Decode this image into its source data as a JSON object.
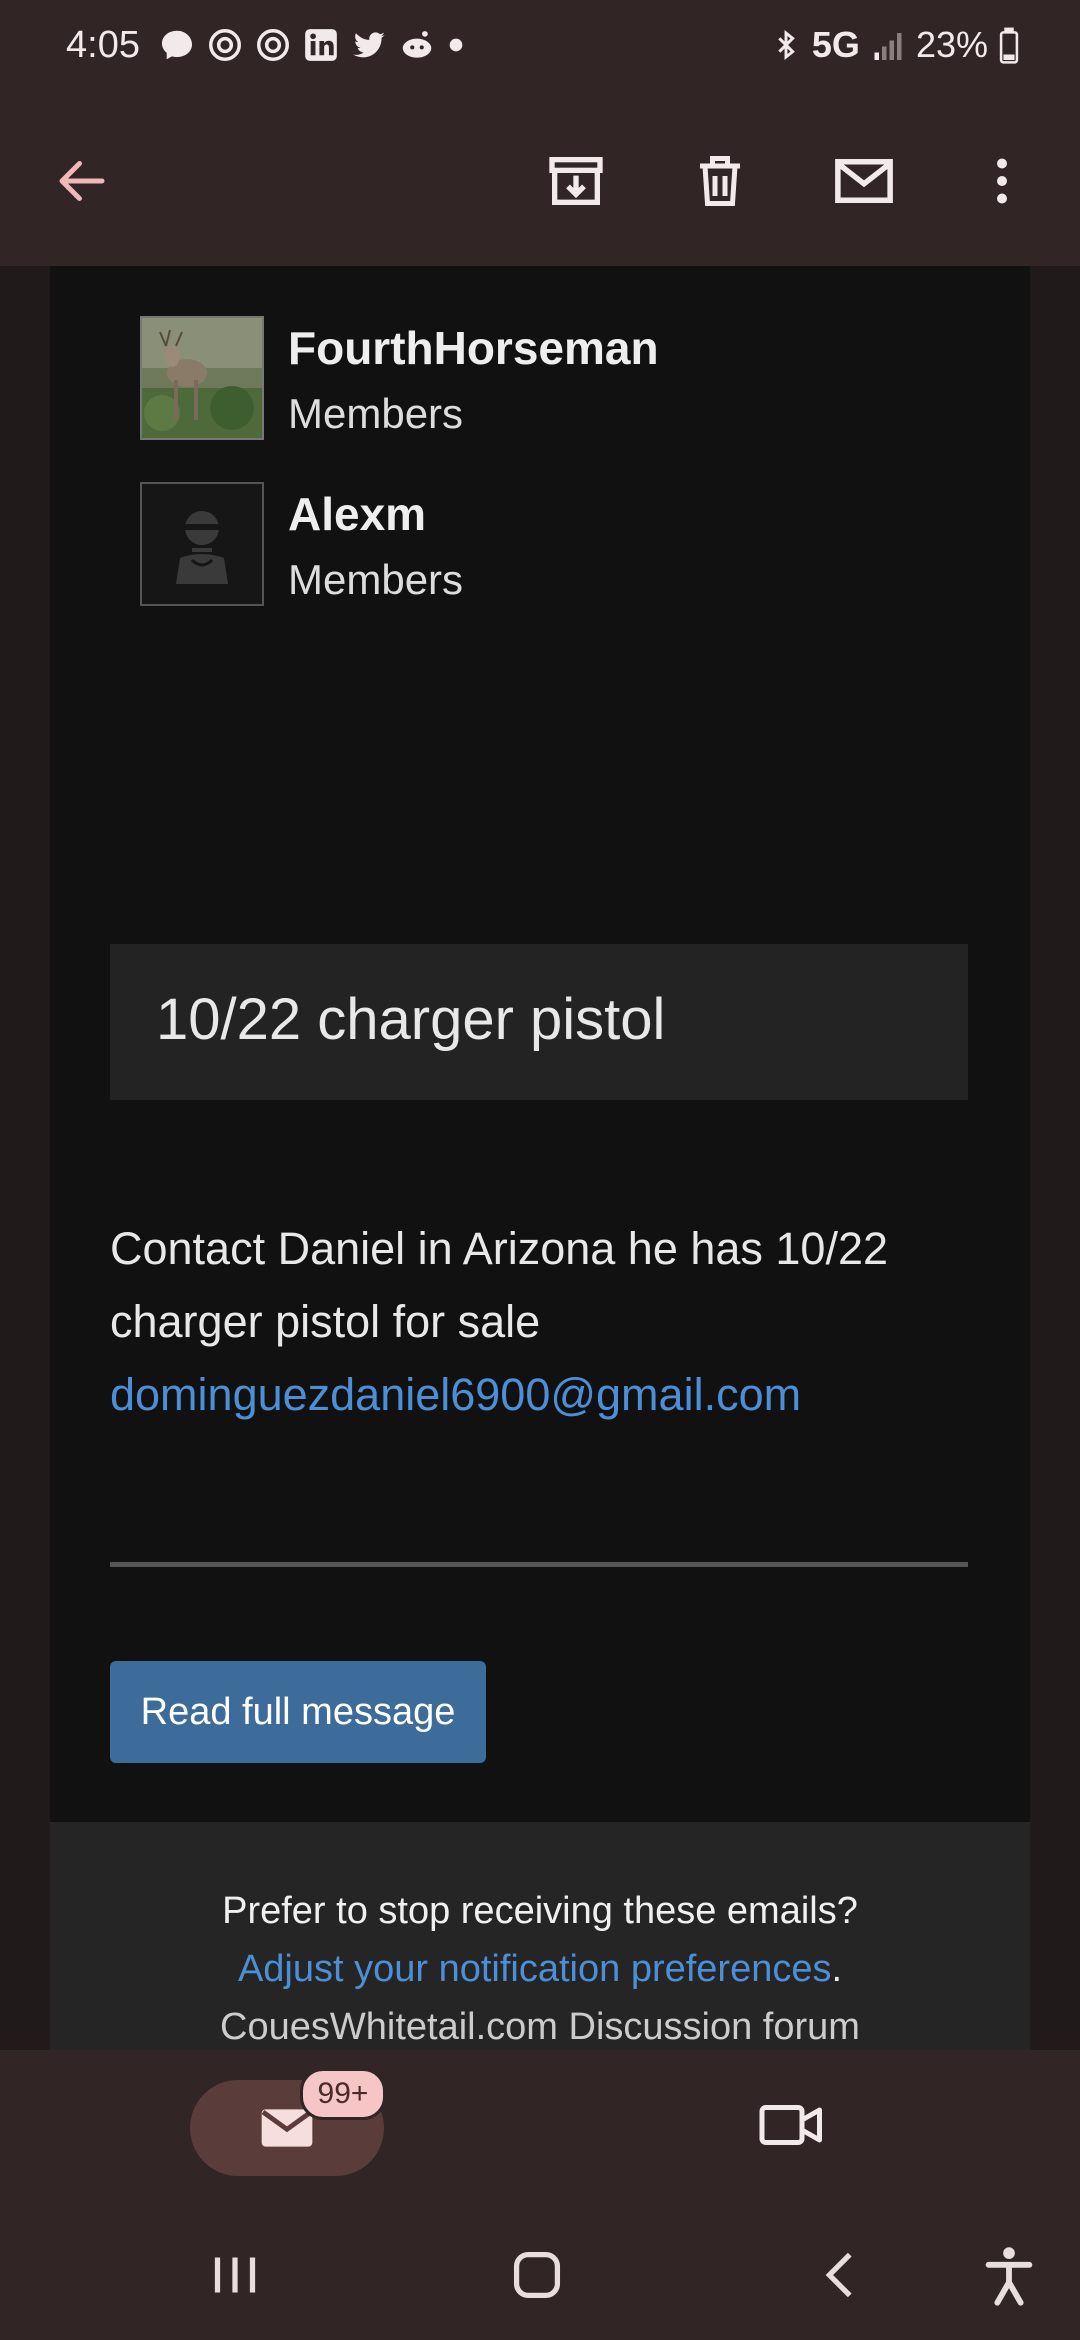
{
  "status_bar": {
    "time": "4:05",
    "network": "5G",
    "battery": "23%",
    "left_icons": [
      "messenger-icon",
      "threads-icon",
      "threads-icon",
      "linkedin-icon",
      "twitter-icon",
      "reddit-icon",
      "dot-icon"
    ],
    "right_icons": [
      "bluetooth-icon",
      "signal-icon",
      "battery-icon"
    ]
  },
  "app_bar": {
    "icons": [
      "back-arrow-icon",
      "archive-icon",
      "delete-icon",
      "mark-unread-icon",
      "more-vert-icon"
    ]
  },
  "members": [
    {
      "name": "FourthHorseman",
      "role": "Members",
      "avatar": "deer-photo"
    },
    {
      "name": "Alexm",
      "role": "Members",
      "avatar": "default-user-silhouette"
    }
  ],
  "post": {
    "title": "10/22 charger pistol",
    "body": "Contact Daniel in Arizona he has 10/22 charger pistol for sale",
    "email_link": "dominguezdaniel6900@gmail.com",
    "read_button": "Read full message"
  },
  "footer": {
    "question": "Prefer to stop receiving these emails?",
    "link": "Adjust your notification preferences",
    "period": ".",
    "site": "CouesWhitetail.com Discussion forum"
  },
  "bottom_nav": {
    "mail_badge": "99+",
    "icons": [
      "mail-icon",
      "meet-video-icon"
    ]
  },
  "system_nav": {
    "icons": [
      "recents-icon",
      "home-icon",
      "back-icon",
      "accessibility-icon"
    ]
  },
  "colors": {
    "bar_bg": "#312525",
    "card_bg": "#111111",
    "link": "#4d8fd6",
    "button": "#3d6b9a",
    "badge": "#f6c6c6"
  }
}
